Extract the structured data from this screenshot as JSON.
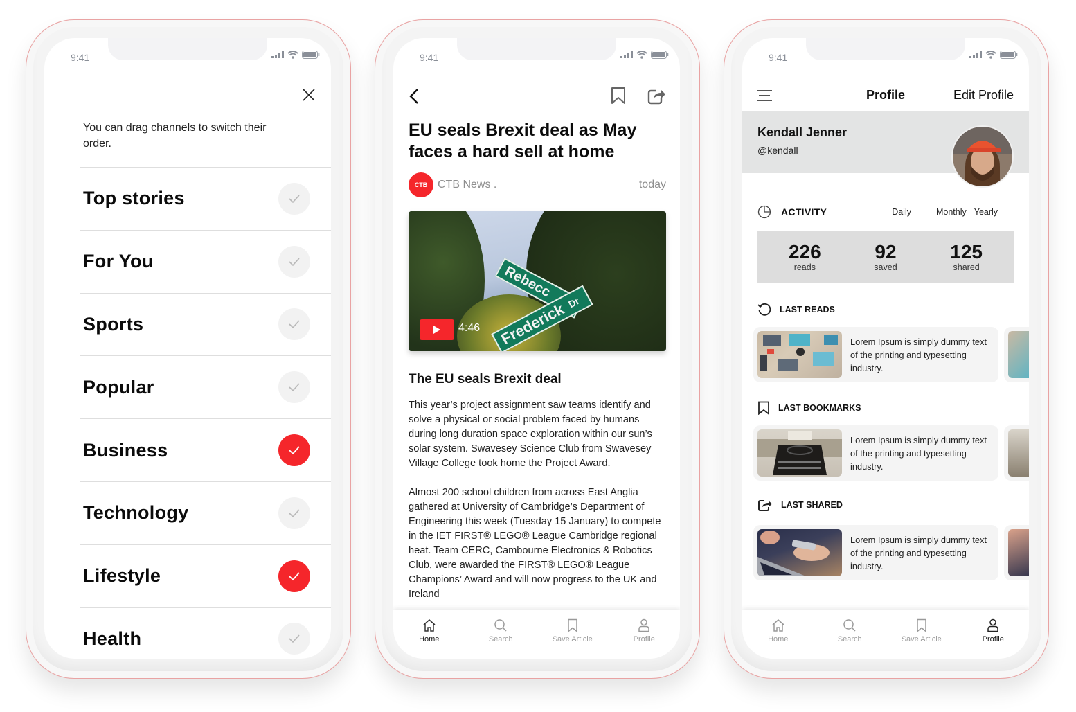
{
  "status_bar": {
    "time": "9:41"
  },
  "screen1": {
    "hint": "You can drag channels to switch their order.",
    "channels": [
      {
        "name": "Top stories",
        "selected": false
      },
      {
        "name": "For You",
        "selected": false
      },
      {
        "name": "Sports",
        "selected": false
      },
      {
        "name": "Popular",
        "selected": false
      },
      {
        "name": "Business",
        "selected": true
      },
      {
        "name": "Technology",
        "selected": false
      },
      {
        "name": "Lifestyle",
        "selected": true
      },
      {
        "name": "Health",
        "selected": false
      }
    ]
  },
  "screen2": {
    "headline": "EU seals Brexit deal as May faces a hard sell at home",
    "source_logo": "CTB",
    "source": "CTB News .",
    "date": "today",
    "video": {
      "duration": "4:46",
      "sign_top": "Rebecc",
      "sign_bottom": "Frederick",
      "sign_suffix": "Dr"
    },
    "sub_headline": "The EU seals Brexit deal",
    "paragraphs": [
      "This year’s project assignment saw teams identify and solve a physical or social problem faced by humans during long duration space exploration within our sun’s solar system. Swavesey Science Club from Swavesey Village College took home the Project Award.",
      "Almost 200 school children from across East Anglia gathered at University of Cambridge’s Department of Engineering this week (Tuesday 15 January) to compete in the IET FIRST® LEGO® League Cambridge regional heat. Team CERC, Cambourne Electronics & Robotics Club, were awarded the FIRST® LEGO® League Champions’ Award and will now progress to the UK and Ireland"
    ],
    "tabs": [
      {
        "label": "Home",
        "icon": "home-icon",
        "active": true
      },
      {
        "label": "Search",
        "icon": "search-icon",
        "active": false
      },
      {
        "label": "Save Article",
        "icon": "bookmark-icon",
        "active": false
      },
      {
        "label": "Profile",
        "icon": "user-icon",
        "active": false
      }
    ]
  },
  "screen3": {
    "title": "Profile",
    "edit_label": "Edit Profile",
    "name": "Kendall Jenner",
    "handle": "@kendall",
    "activity": {
      "title": "ACTIVITY",
      "periods": [
        "Daily",
        "Monthly",
        "Yearly"
      ],
      "stats": [
        {
          "value": "226",
          "label": "reads"
        },
        {
          "value": "92",
          "label": "saved"
        },
        {
          "value": "125",
          "label": "shared"
        }
      ]
    },
    "sections": [
      {
        "title": "LAST READS",
        "card_text": "Lorem Ipsum is simply dummy text of the printing and typesetting industry."
      },
      {
        "title": "LAST BOOKMARKS",
        "card_text": "Lorem Ipsum is simply dummy text of the printing and typesetting industry."
      },
      {
        "title": "LAST SHARED",
        "card_text": "Lorem Ipsum is simply dummy text of the printing and typesetting industry."
      }
    ],
    "tabs": [
      {
        "label": "Home",
        "icon": "home-icon",
        "active": false
      },
      {
        "label": "Search",
        "icon": "search-icon",
        "active": false
      },
      {
        "label": "Save Article",
        "icon": "bookmark-icon",
        "active": false
      },
      {
        "label": "Profile",
        "icon": "user-icon",
        "active": true
      }
    ]
  },
  "colors": {
    "accent": "#f5262b",
    "band": "#e3e4e4",
    "stats_bg": "#dddddd",
    "card_bg": "#f4f4f4"
  }
}
